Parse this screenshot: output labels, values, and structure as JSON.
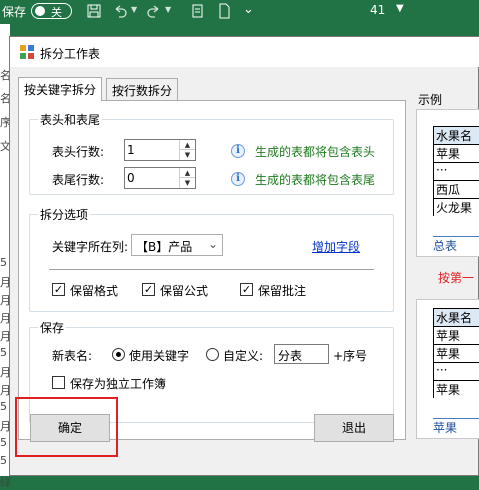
{
  "excel": {
    "autosave_label": "保存",
    "toggle_label": "关",
    "cell_number": "41",
    "row_labels": [
      "名",
      "名",
      "序",
      "文",
      "5",
      "月",
      "月",
      "月",
      "月",
      "5",
      "月",
      "月",
      "5",
      "月",
      "5",
      "5",
      "绿"
    ]
  },
  "dialog": {
    "title": "拆分工作表",
    "tabs": [
      "按关键字拆分",
      "按行数拆分"
    ],
    "header_group": {
      "title": "表头和表尾",
      "header_rows_label": "表头行数:",
      "header_rows_value": "1",
      "header_note": "生成的表都将包含表头",
      "footer_rows_label": "表尾行数:",
      "footer_rows_value": "0",
      "footer_note": "生成的表都将包含表尾"
    },
    "split_group": {
      "title": "拆分选项",
      "key_column_label": "关键字所在列:",
      "key_column_value": "【B】产品",
      "add_field_link": "增加字段",
      "keep_format": "保留格式",
      "keep_formula": "保留公式",
      "keep_comment": "保留批注"
    },
    "save_group": {
      "title": "保存",
      "new_name_label": "新表名:",
      "use_keyword": "使用关键字",
      "custom": "自定义:",
      "custom_value": "分表",
      "suffix": "+序号",
      "save_as_workbook": "保存为独立工作簿"
    },
    "ok_button": "确定",
    "exit_button": "退出",
    "example": {
      "label": "示例",
      "table1": [
        "水果名",
        "苹果",
        "···",
        "西瓜",
        "火龙果"
      ],
      "tab1": "总表",
      "arrow_text": "按第一",
      "table2": [
        "水果名",
        "苹果",
        "苹果",
        "···",
        "苹果"
      ],
      "tab2": "苹果"
    }
  },
  "colors": {
    "excel_green": "#217346",
    "highlight_red": "#e02020",
    "note_green": "#1f7a1f",
    "link_blue": "#0033cc"
  }
}
